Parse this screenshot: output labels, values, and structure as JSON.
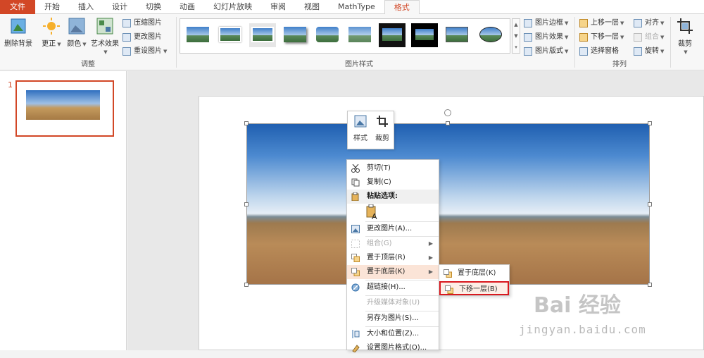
{
  "tabs": [
    "文件",
    "开始",
    "插入",
    "设计",
    "切换",
    "动画",
    "幻灯片放映",
    "审阅",
    "视图",
    "MathType",
    "格式"
  ],
  "active_tab": "格式",
  "ribbon": {
    "adjust": {
      "remove_bg": "删除背景",
      "correct": "更正",
      "color": "颜色",
      "art_effects": "艺术效果",
      "compress": "压缩图片",
      "change": "更改图片",
      "reset": "重设图片",
      "label": "调整"
    },
    "styles": {
      "label": "图片样式",
      "border": "图片边框",
      "effects": "图片效果",
      "layout": "图片版式"
    },
    "arrange": {
      "label": "排列",
      "bring_forward": "上移一层",
      "send_backward": "下移一层",
      "selection_pane": "选择窗格",
      "align": "对齐",
      "group": "组合",
      "rotate": "旋转"
    },
    "size": {
      "crop": "裁剪"
    }
  },
  "panel": {
    "slide_number": "1"
  },
  "minibar": {
    "style": "样式",
    "crop": "裁剪"
  },
  "context_menu": {
    "cut": "剪切(T)",
    "copy": "复制(C)",
    "paste_options": "粘贴选项:",
    "change_picture": "更改图片(A)...",
    "group": "组合(G)",
    "bring_front": "置于顶层(R)",
    "send_back": "置于底层(K)",
    "hyperlink": "超链接(H)...",
    "upgrade_media": "升级媒体对象(U)",
    "save_as": "另存为图片(S)...",
    "size_pos": "大小和位置(Z)...",
    "format_picture": "设置图片格式(O)..."
  },
  "submenu": {
    "send_to_back": "置于底层(K)",
    "send_backward": "下移一层(B)"
  },
  "watermark": {
    "brand": "Bai 经验",
    "url": "jingyan.baidu.com"
  }
}
